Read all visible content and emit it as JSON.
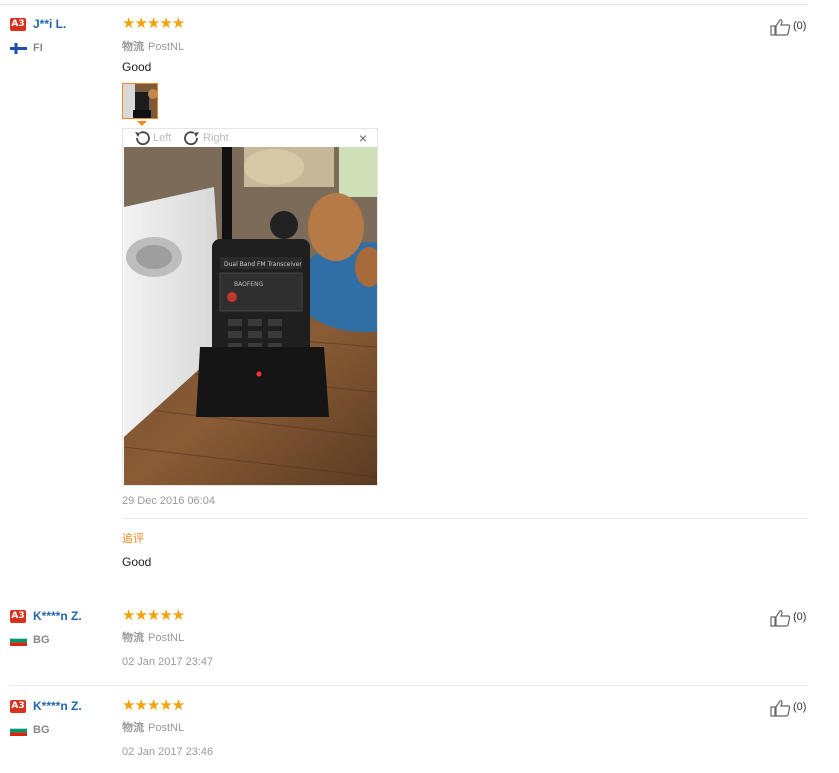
{
  "reviews": [
    {
      "level": "A3",
      "user": "J**i L.",
      "country": "FI",
      "stars": "★★★★★",
      "logistics_label": "物流",
      "logistics": "PostNL",
      "text": "Good",
      "date": "29 Dec 2016 06:04",
      "likes": "(0)",
      "additional_label": "追评",
      "additional_text": "Good"
    },
    {
      "level": "A3",
      "user": "K****n Z.",
      "country": "BG",
      "stars": "★★★★★",
      "logistics_label": "物流",
      "logistics": "PostNL",
      "date": "02 Jan 2017 23:47",
      "likes": "(0)"
    },
    {
      "level": "A3",
      "user": "K****n Z.",
      "country": "BG",
      "stars": "★★★★★",
      "logistics_label": "物流",
      "logistics": "PostNL",
      "date": "02 Jan 2017 23:46",
      "likes": "(0)"
    }
  ],
  "viewer": {
    "rotate_left": "Left",
    "rotate_right": "Right",
    "close": "×",
    "photo_text_top": "Dual Band FM Transceiver",
    "photo_text_brand": "BAOFENG"
  },
  "icons": {
    "like": "thumbs-up-icon",
    "rotate_left": "rotate-left-icon",
    "rotate_right": "rotate-right-icon",
    "close": "close-icon",
    "flag_fi": "finland-flag-icon",
    "flag_bg": "bulgaria-flag-icon"
  },
  "colors": {
    "star": "#f0a30a",
    "username": "#2266aa",
    "level_badge": "#d8321f",
    "additional_label": "#e98b1c",
    "thumb_border": "#f08a24"
  }
}
